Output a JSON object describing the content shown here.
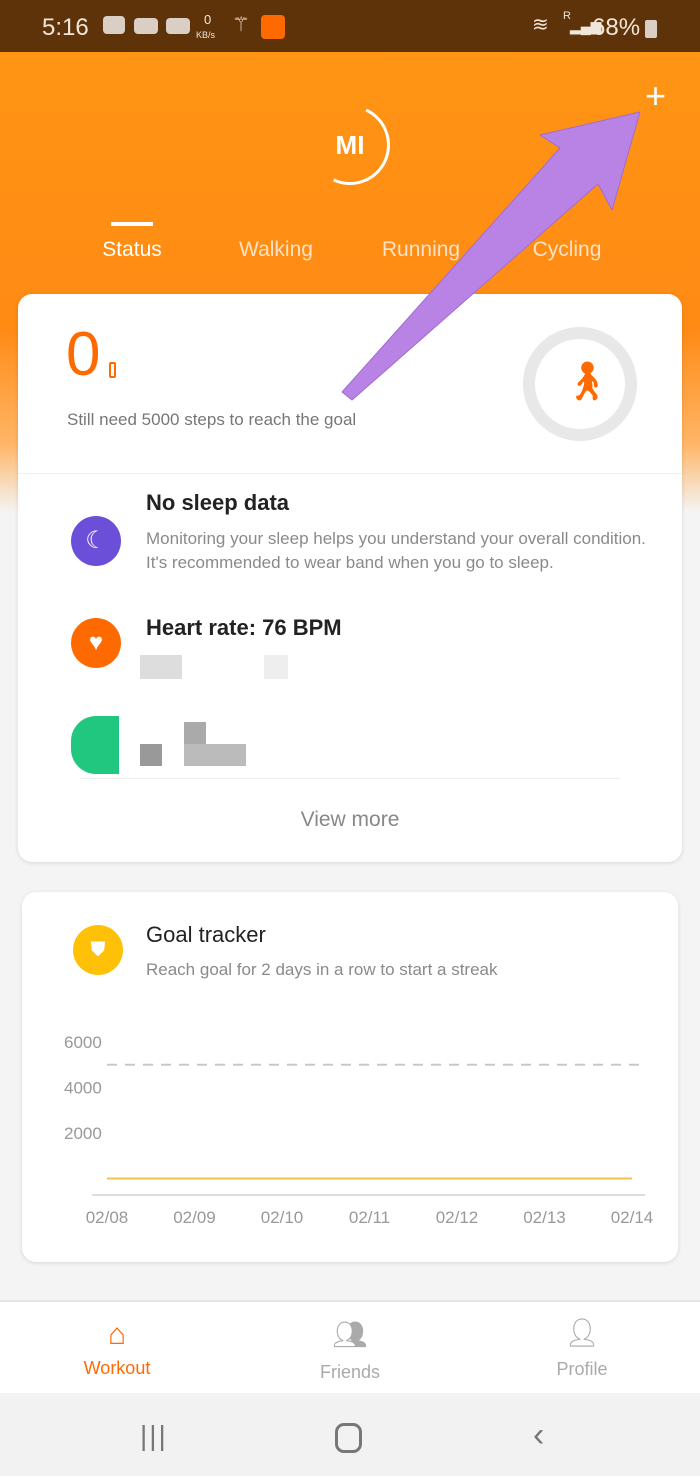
{
  "status_bar": {
    "time": "5:16",
    "net_speed": "0",
    "net_unit": "KB/s",
    "battery": "68%",
    "roaming": "R"
  },
  "header": {
    "logo": "MI",
    "add_icon": "plus-icon",
    "tabs": [
      {
        "label": "Status",
        "active": true
      },
      {
        "label": "Walking"
      },
      {
        "label": "Running"
      },
      {
        "label": "Cycling"
      }
    ]
  },
  "steps_card": {
    "steps": "0",
    "goal_text": "Still need 5000 steps to reach the goal",
    "progress": 0
  },
  "sleep": {
    "title": "No sleep data",
    "desc": "Monitoring your sleep helps you understand your overall condition. It's recommended to wear band when you go to sleep."
  },
  "heart": {
    "title": "Heart rate: 76 BPM"
  },
  "view_more": "View more",
  "goal_tracker": {
    "title": "Goal tracker",
    "subtitle": "Reach goal for 2 days in a row to start a streak"
  },
  "chart_data": {
    "type": "line",
    "categories": [
      "02/08",
      "02/09",
      "02/10",
      "02/11",
      "02/12",
      "02/13",
      "02/14"
    ],
    "values": [
      0,
      0,
      0,
      0,
      0,
      0,
      0
    ],
    "goal": 5000,
    "yticks": [
      "6000",
      "4000",
      "2000"
    ],
    "ylim": [
      0,
      6000
    ],
    "line_color": "#f5c24a",
    "goal_line": "dashed"
  },
  "bottom_nav": [
    {
      "label": "Workout",
      "active": true
    },
    {
      "label": "Friends"
    },
    {
      "label": "Profile"
    }
  ],
  "colors": {
    "accent": "#ff6a00",
    "header": "#ff8f14",
    "sleep": "#6b4fd8",
    "heart": "#ff6a00",
    "green": "#22c77f",
    "annotation": "#b983e6"
  }
}
